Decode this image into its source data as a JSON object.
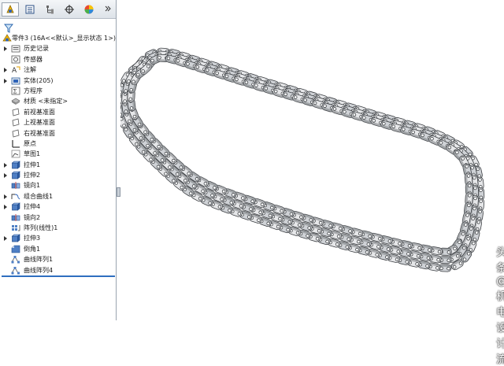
{
  "feature_tree": {
    "tabs": [
      {
        "name": "featuremanager-tab",
        "active": true
      },
      {
        "name": "propertymanager-tab",
        "active": false
      },
      {
        "name": "configurationmanager-tab",
        "active": false
      },
      {
        "name": "dimxpert-tab",
        "active": false
      },
      {
        "name": "display-manager-tab",
        "active": false
      }
    ],
    "root": {
      "label": "零件3 (16A<<默认>_显示状态 1>)",
      "icon": "part-icon"
    },
    "items": [
      {
        "label": "历史记录",
        "icon": "history-folder-icon",
        "expandable": true
      },
      {
        "label": "传感器",
        "icon": "sensor-icon",
        "expandable": false
      },
      {
        "label": "注解",
        "icon": "annotations-icon",
        "expandable": true
      },
      {
        "label": "实体(205)",
        "icon": "solid-bodies-icon",
        "expandable": true
      },
      {
        "label": "方程序",
        "icon": "equations-icon",
        "expandable": false
      },
      {
        "label": "材质 <未指定>",
        "icon": "material-icon",
        "expandable": false
      },
      {
        "label": "前视基准面",
        "icon": "plane-icon",
        "expandable": false
      },
      {
        "label": "上视基准面",
        "icon": "plane-icon",
        "expandable": false
      },
      {
        "label": "右视基准面",
        "icon": "plane-icon",
        "expandable": false
      },
      {
        "label": "原点",
        "icon": "origin-icon",
        "expandable": false
      },
      {
        "label": "草图1",
        "icon": "sketch-icon",
        "expandable": false
      },
      {
        "label": "拉伸1",
        "icon": "extrude-icon",
        "expandable": true
      },
      {
        "label": "拉伸2",
        "icon": "extrude-icon",
        "expandable": true
      },
      {
        "label": "镜向1",
        "icon": "mirror-icon",
        "expandable": false
      },
      {
        "label": "组合曲线1",
        "icon": "composite-curve-icon",
        "expandable": true
      },
      {
        "label": "拉伸4",
        "icon": "extrude-icon",
        "expandable": true
      },
      {
        "label": "镜向2",
        "icon": "mirror-icon",
        "expandable": false
      },
      {
        "label": "阵列(线性)1",
        "icon": "linear-pattern-icon",
        "expandable": false
      },
      {
        "label": "拉伸3",
        "icon": "extrude-icon",
        "expandable": true
      },
      {
        "label": "倒角1",
        "icon": "chamfer-icon",
        "expandable": false
      },
      {
        "label": "曲线阵列1",
        "icon": "curve-pattern-icon",
        "expandable": false
      },
      {
        "label": "曲线阵列4",
        "icon": "curve-pattern-icon",
        "expandable": false
      }
    ]
  },
  "viewport": {
    "model": "roller-chain-model",
    "watermark": "头条 @机电设计流"
  },
  "colors": {
    "accent": "#2f6fbf",
    "link_plate_light": "#e6e7e9",
    "link_plate_dark": "#7b7f84",
    "background": "#ffffff"
  }
}
